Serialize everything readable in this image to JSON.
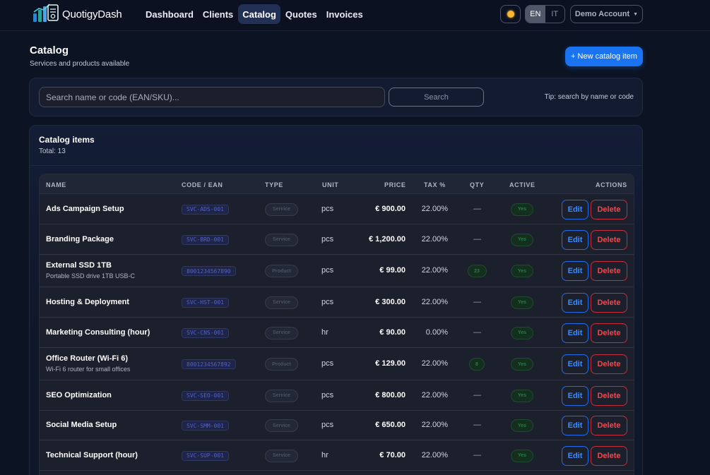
{
  "header": {
    "app_name": "QuotigyDash",
    "nav": [
      {
        "label": "Dashboard",
        "active": false
      },
      {
        "label": "Clients",
        "active": false
      },
      {
        "label": "Catalog",
        "active": true
      },
      {
        "label": "Quotes",
        "active": false
      },
      {
        "label": "Invoices",
        "active": false
      }
    ],
    "theme_icon": "sun-icon",
    "lang_options": [
      "EN",
      "IT"
    ],
    "lang_selected": "EN",
    "account_label": "Demo Account",
    "account_caret": "▼"
  },
  "page": {
    "title": "Catalog",
    "subtitle": "Services and products available",
    "new_button": "+ New catalog item"
  },
  "search": {
    "placeholder": "Search name or code (EAN/SKU)...",
    "button": "Search",
    "tip": "Tip: search by name or code"
  },
  "catalog": {
    "title": "Catalog items",
    "total": "Total: 13",
    "columns": [
      "NAME",
      "CODE / EAN",
      "TYPE",
      "UNIT",
      "PRICE",
      "TAX %",
      "QTY",
      "ACTIVE",
      "ACTIONS"
    ],
    "rows": [
      {
        "name": "Ads Campaign Setup",
        "desc": "",
        "code": "SVC-ADS-001",
        "type": "Service",
        "unit": "pcs",
        "price": "€ 900.00",
        "tax": "22.00%",
        "qty": "—",
        "active": "Yes",
        "edit": "Edit",
        "delete": "Delete"
      },
      {
        "name": "Branding Package",
        "desc": "",
        "code": "SVC-BRD-001",
        "type": "Service",
        "unit": "pcs",
        "price": "€ 1,200.00",
        "tax": "22.00%",
        "qty": "—",
        "active": "Yes",
        "edit": "Edit",
        "delete": "Delete"
      },
      {
        "name": "External SSD 1TB",
        "desc": "Portable SSD drive 1TB USB-C",
        "code": "8001234567890",
        "type": "Product",
        "unit": "pcs",
        "price": "€ 99.00",
        "tax": "22.00%",
        "qty": "23",
        "active": "Yes",
        "edit": "Edit",
        "delete": "Delete"
      },
      {
        "name": "Hosting & Deployment",
        "desc": "",
        "code": "SVC-HST-001",
        "type": "Service",
        "unit": "pcs",
        "price": "€ 300.00",
        "tax": "22.00%",
        "qty": "—",
        "active": "Yes",
        "edit": "Edit",
        "delete": "Delete"
      },
      {
        "name": "Marketing Consulting (hour)",
        "desc": "",
        "code": "SVC-CNS-001",
        "type": "Service",
        "unit": "hr",
        "price": "€ 90.00",
        "tax": "0.00%",
        "qty": "—",
        "active": "Yes",
        "edit": "Edit",
        "delete": "Delete"
      },
      {
        "name": "Office Router (Wi-Fi 6)",
        "desc": "Wi-Fi 6 router for small offices",
        "code": "8001234567892",
        "type": "Product",
        "unit": "pcs",
        "price": "€ 129.00",
        "tax": "22.00%",
        "qty": "8",
        "active": "Yes",
        "edit": "Edit",
        "delete": "Delete"
      },
      {
        "name": "SEO Optimization",
        "desc": "",
        "code": "SVC-SEO-001",
        "type": "Service",
        "unit": "pcs",
        "price": "€ 800.00",
        "tax": "22.00%",
        "qty": "—",
        "active": "Yes",
        "edit": "Edit",
        "delete": "Delete"
      },
      {
        "name": "Social Media Setup",
        "desc": "",
        "code": "SVC-SMM-001",
        "type": "Service",
        "unit": "pcs",
        "price": "€ 650.00",
        "tax": "22.00%",
        "qty": "—",
        "active": "Yes",
        "edit": "Edit",
        "delete": "Delete"
      },
      {
        "name": "Technical Support (hour)",
        "desc": "",
        "code": "SVC-SUP-001",
        "type": "Service",
        "unit": "hr",
        "price": "€ 70.00",
        "tax": "22.00%",
        "qty": "—",
        "active": "Yes",
        "edit": "Edit",
        "delete": "Delete"
      }
    ]
  }
}
